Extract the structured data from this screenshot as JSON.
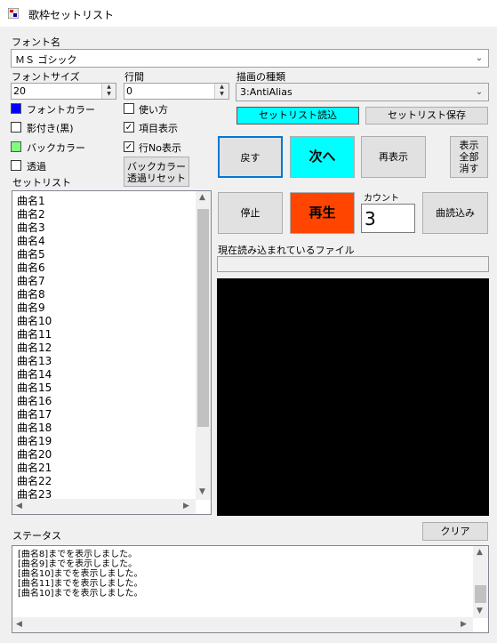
{
  "window": {
    "title": "歌枠セットリスト"
  },
  "font_name": {
    "label": "フォント名",
    "value": "ＭＳ ゴシック"
  },
  "font_size": {
    "label": "フォントサイズ",
    "value": "20"
  },
  "line_spacing": {
    "label": "行間",
    "value": "0"
  },
  "draw_type": {
    "label": "描画の種類",
    "value": "3:AntiAlias"
  },
  "options": {
    "font_color": "フォントカラー",
    "shadow": "影付き(黒)",
    "back_color": "バックカラー",
    "transparent": "透過",
    "usage": "使い方",
    "item_display": "項目表示",
    "row_no_display": "行No表示",
    "back_color_reset": "バックカラー透過リセット"
  },
  "colors": {
    "font_color": "#0000ff",
    "back_color": "#80ff80",
    "load_button": "#00ffff",
    "next_button": "#00ffff",
    "play_button": "#ff4500",
    "preview": "#000000"
  },
  "buttons": {
    "load_setlist": "セットリスト読込",
    "save_setlist": "セットリスト保存",
    "back": "戻す",
    "next": "次へ",
    "redisplay": "再表示",
    "show_all_1": "表示",
    "show_all_2": "全部",
    "show_all_3": "消す",
    "stop": "停止",
    "play": "再生",
    "load_song": "曲読込み",
    "clear": "クリア"
  },
  "count": {
    "label": "カウント",
    "value": "3"
  },
  "current_file": {
    "label": "現在読み込まれているファイル",
    "value": ""
  },
  "setlist": {
    "label": "セットリスト",
    "items": [
      "曲名1",
      "曲名2",
      "曲名3",
      "曲名4",
      "曲名5",
      "曲名6",
      "曲名7",
      "曲名8",
      "曲名9",
      "曲名10",
      "曲名11",
      "曲名12",
      "曲名13",
      "曲名14",
      "曲名15",
      "曲名16",
      "曲名17",
      "曲名18",
      "曲名19",
      "曲名20",
      "曲名21",
      "曲名22",
      "曲名23"
    ]
  },
  "status": {
    "label": "ステータス",
    "lines": [
      "[曲名8]までを表示しました。",
      "[曲名9]までを表示しました。",
      "[曲名10]までを表示しました。",
      "[曲名11]までを表示しました。",
      "[曲名10]までを表示しました。"
    ]
  }
}
